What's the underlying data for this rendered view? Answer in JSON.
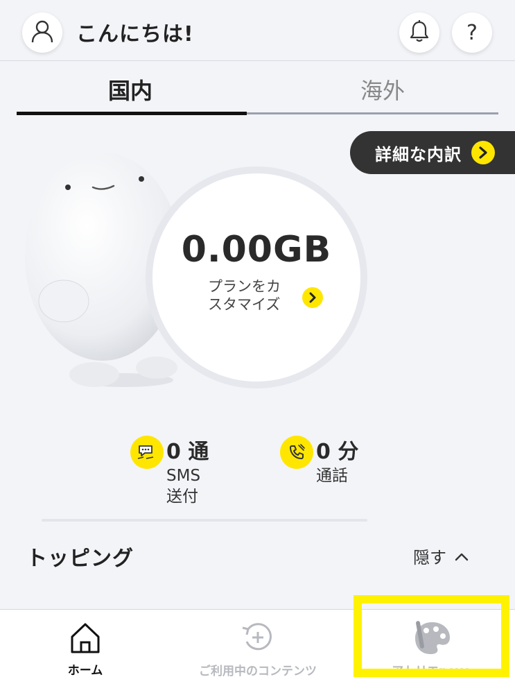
{
  "header": {
    "greeting": "こんにちは!",
    "avatar_icon": "user-icon",
    "bell_icon": "bell-icon",
    "help_label": "?"
  },
  "tabs": [
    {
      "label": "国内",
      "active": true
    },
    {
      "label": "海外",
      "active": false
    }
  ],
  "breakdown": {
    "label": "詳細な内訳",
    "icon": "chevron-right-icon"
  },
  "data_usage": {
    "amount": "0.00GB",
    "customize_line1": "プランをカ",
    "customize_line2": "スタマイズ"
  },
  "stats": {
    "sms": {
      "value": "0 通",
      "label_line1": "SMS",
      "label_line2": "送付",
      "icon": "chat-bubble-icon"
    },
    "call": {
      "value": "0 分",
      "label": "通話",
      "icon": "phone-icon"
    }
  },
  "topping": {
    "title": "トッピング",
    "hide_label": "隠す"
  },
  "bottom_nav": [
    {
      "label": "ホーム",
      "icon": "home-icon",
      "active": true
    },
    {
      "label": "ご利用中のコンテンツ",
      "icon": "refresh-plus-icon",
      "active": false
    },
    {
      "label": "アトリエpovo",
      "icon": "palette-icon",
      "active": false
    }
  ],
  "colors": {
    "accent_yellow": "#ffe600",
    "highlight_yellow": "#fff200",
    "dark": "#333333",
    "background": "#f3f4f8"
  }
}
